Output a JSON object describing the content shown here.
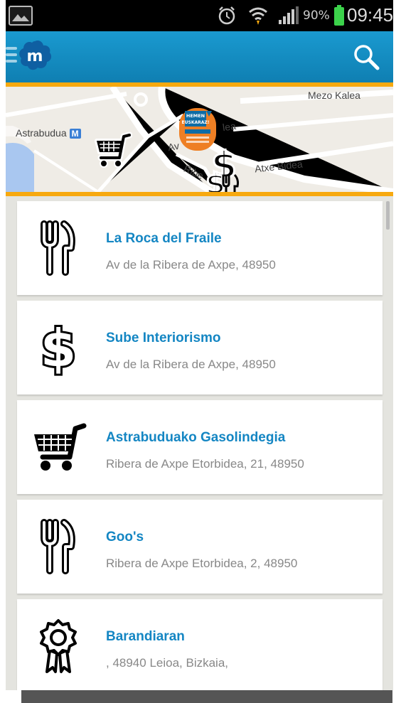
{
  "status_bar": {
    "battery_percent": "90%",
    "time": "09:45",
    "icons": [
      "gallery-icon",
      "alarm-icon",
      "wifi-icon",
      "signal-icon",
      "battery-icon"
    ]
  },
  "action_bar": {
    "logo_letter": "m",
    "icons": [
      "menu-icon",
      "app-logo-icon",
      "search-icon"
    ],
    "accent_color": "#f7a90f",
    "bar_color": "#1486c3"
  },
  "map": {
    "labels": {
      "astrabudua": "Astrabudua",
      "metro_badge": "M",
      "mezo_kalea": "Mezo Kalea",
      "atxe_bidea": "Atxe Bidea",
      "ribe": "Ribe",
      "lea": "lea",
      "av": "Av"
    },
    "marker_text": {
      "line1": "HEMEN",
      "line2": "EUSKARAZ!"
    },
    "markers": [
      "cart-marker",
      "dollar-marker",
      "dollar-marker",
      "fork-knife-marker",
      "euskaraz-badge-marker"
    ]
  },
  "places": [
    {
      "name": "La Roca del Fraile",
      "address": "Av de la Ribera de Axpe, 48950",
      "icon": "fork-knife-icon"
    },
    {
      "name": "Sube Interiorismo",
      "address": "Av de la Ribera de Axpe, 48950",
      "icon": "dollar-icon"
    },
    {
      "name": "Astrabuduako Gasolindegia",
      "address": "Ribera de Axpe Etorbidea, 21, 48950",
      "icon": "shopping-cart-icon"
    },
    {
      "name": "Goo's",
      "address": "Ribera de Axpe Etorbidea, 2, 48950",
      "icon": "fork-knife-icon"
    },
    {
      "name": "Barandiaran",
      "address": ", 48940 Leioa, Bizkaia,",
      "icon": "award-ribbon-icon"
    }
  ]
}
